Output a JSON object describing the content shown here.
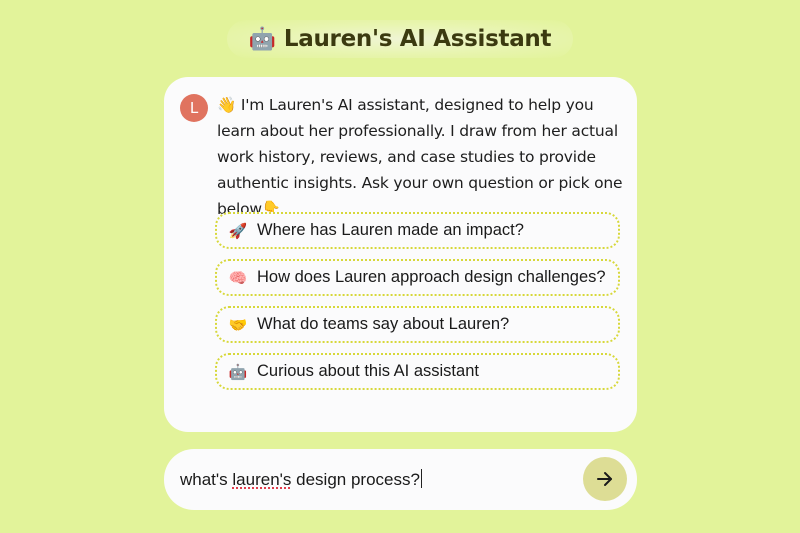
{
  "header": {
    "icon": "robot-icon",
    "icon_glyph": "🤖",
    "title": "Lauren's AI Assistant"
  },
  "chat": {
    "avatar_letter": "L",
    "avatar_color": "#e0735f",
    "message": "👋 I'm Lauren's AI assistant, designed to help you learn about her professionally. I draw from her actual work history, reviews, and case studies to provide authentic insights. Ask your own question or pick one below👇",
    "suggestions": [
      {
        "icon": "rocket-icon",
        "glyph": "🚀",
        "label": "Where has Lauren made an impact?"
      },
      {
        "icon": "brain-icon",
        "glyph": "🧠",
        "label": "How does Lauren approach design challenges?"
      },
      {
        "icon": "handshake-icon",
        "glyph": "🤝",
        "label": "What do teams say about Lauren?"
      },
      {
        "icon": "robot-icon",
        "glyph": "🤖",
        "label": "Curious about this AI assistant"
      }
    ]
  },
  "composer": {
    "value_prefix": "what's ",
    "value_misspelled": "lauren's",
    "value_suffix": " design process?",
    "send_icon": "arrow-right-icon",
    "send_button_color": "#dddd95"
  },
  "colors": {
    "background": "#e2f39a",
    "card": "#fbfbfc",
    "suggestion_border": "#d7d83a"
  }
}
